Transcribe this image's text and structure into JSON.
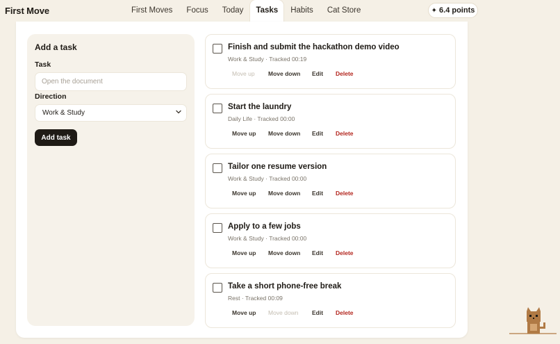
{
  "brand": "First Move",
  "nav": {
    "tabs": [
      {
        "label": "First Moves",
        "active": false
      },
      {
        "label": "Focus",
        "active": false
      },
      {
        "label": "Today",
        "active": false
      },
      {
        "label": "Tasks",
        "active": true
      },
      {
        "label": "Habits",
        "active": false
      },
      {
        "label": "Cat Store",
        "active": false
      }
    ]
  },
  "points": {
    "icon": "sparkle-icon",
    "label": "6.4 points"
  },
  "add_task": {
    "title": "Add a task",
    "task_label": "Task",
    "task_placeholder": "Open the document",
    "direction_label": "Direction",
    "direction_value": "Work & Study",
    "button_label": "Add task"
  },
  "actions": {
    "move_up": "Move up",
    "move_down": "Move down",
    "edit": "Edit",
    "delete": "Delete"
  },
  "tasks": [
    {
      "title": "Finish and submit the hackathon demo video",
      "meta": "Work & Study · Tracked 00:19",
      "move_up_enabled": false,
      "move_down_enabled": true
    },
    {
      "title": "Start the laundry",
      "meta": "Daily Life · Tracked 00:00",
      "move_up_enabled": true,
      "move_down_enabled": true
    },
    {
      "title": "Tailor one resume version",
      "meta": "Work & Study · Tracked 00:00",
      "move_up_enabled": true,
      "move_down_enabled": true
    },
    {
      "title": "Apply to a few jobs",
      "meta": "Work & Study · Tracked 00:00",
      "move_up_enabled": true,
      "move_down_enabled": true
    },
    {
      "title": "Take a short phone-free break",
      "meta": "Rest · Tracked 00:09",
      "move_up_enabled": true,
      "move_down_enabled": false
    }
  ],
  "colors": {
    "background": "#f5f0e6",
    "accent_dark": "#1f1b16",
    "delete": "#b3261e",
    "cat": "#b07a45"
  }
}
